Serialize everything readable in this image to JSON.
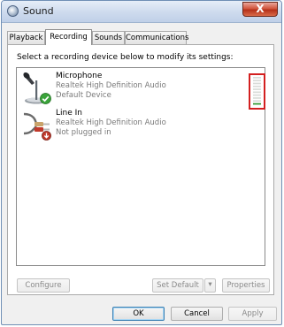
{
  "window": {
    "title": "Sound",
    "close_label": "X",
    "close_color": "#c8452b"
  },
  "tabs": [
    {
      "label": "Playback",
      "active": false
    },
    {
      "label": "Recording",
      "active": true
    },
    {
      "label": "Sounds",
      "active": false
    },
    {
      "label": "Communications",
      "active": false
    }
  ],
  "panel": {
    "instruction": "Select a recording device below to modify its settings:"
  },
  "devices": [
    {
      "name": "Microphone",
      "driver": "Realtek High Definition Audio",
      "status": "Default Device",
      "icon": "microphone-icon",
      "badge": "default-check-icon",
      "level_fraction": 0.05
    },
    {
      "name": "Line In",
      "driver": "Realtek High Definition Audio",
      "status": "Not plugged in",
      "icon": "line-in-cable-icon",
      "badge": "unplugged-arrow-icon"
    }
  ],
  "buttons": {
    "configure": "Configure",
    "set_default": "Set Default",
    "properties": "Properties",
    "ok": "OK",
    "cancel": "Cancel",
    "apply": "Apply"
  },
  "colors": {
    "meter_outline": "#d32020",
    "meter_level": "#2e9a2e",
    "check_badge": "#3aa33a",
    "unplugged_badge": "#c0392b"
  }
}
